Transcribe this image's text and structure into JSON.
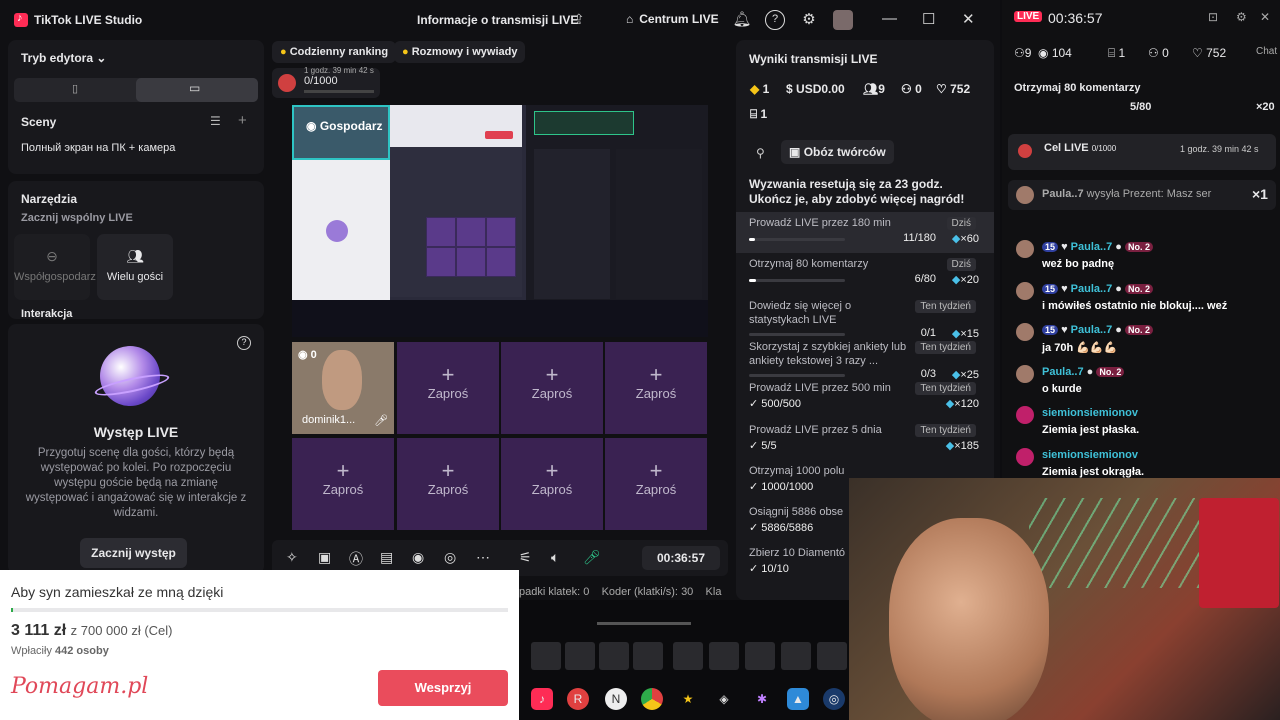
{
  "app": {
    "title": "TikTok LIVE Studio",
    "center_title": "Informacje o transmisji LIVE",
    "home": "Centrum LIVE"
  },
  "left": {
    "editor_mode": "Tryb edytora",
    "scenes": "Sceny",
    "scene_item": "Полный экран на ПК + камера",
    "tools": "Narzędzia",
    "tools_sub": "Zacznij wspólny LIVE",
    "cohost": "Współgospodarz",
    "multi": "Wielu gości",
    "interaction": "Interakcja",
    "perf_title": "Występ LIVE",
    "perf_desc": "Przygotuj scenę dla gości, którzy będą występować po kolei. Po rozpoczęciu występu goście będą na zmianę występować i angażować się w interakcje z widzami.",
    "start_btn": "Zacznij występ"
  },
  "center": {
    "ranking": "Codzienny ranking",
    "talk": "Rozmowy i wywiady",
    "goal": "0/1000",
    "goal_time": "1 godz. 39 min 42 s",
    "host_label": "Gospodarz",
    "cam_count": "0",
    "cam_name": "dominik1...",
    "invite": "Zaproś",
    "timer": "00:36:57"
  },
  "results": {
    "title": "Wyniki transmisji LIVE",
    "s1": "1",
    "s2": "USD0.00",
    "s3": "9",
    "s4": "0",
    "s5": "752",
    "s6": "1",
    "creators": "Obóz twórców",
    "reset": "Wyzwania resetują się za 23 godz. Ukończ je, aby zdobyć więcej nagród!",
    "tasks": [
      {
        "t": "Prowadź LIVE przez 180 min",
        "badge": "Dziś",
        "cnt": "11/180",
        "rw": "×60",
        "p": 0.06
      },
      {
        "t": "Otrzymaj 80 komentarzy",
        "badge": "Dziś",
        "cnt": "6/80",
        "rw": "×20",
        "p": 0.075
      },
      {
        "t": "Dowiedz się więcej o statystykach LIVE",
        "badge": "Ten tydzień",
        "cnt": "0/1",
        "rw": "×15",
        "p": 0
      },
      {
        "t": "Skorzystaj z szybkiej ankiety lub ankiety tekstowej 3 razy ...",
        "badge": "Ten tydzień",
        "cnt": "0/3",
        "rw": "×25",
        "p": 0
      },
      {
        "t": "Prowadź LIVE przez 500 min",
        "badge": "Ten tydzień",
        "cnt": "500/500",
        "rw": "×120",
        "done": true
      },
      {
        "t": "Prowadź LIVE przez 5 dnia",
        "badge": "Ten tydzień",
        "cnt": "5/5",
        "rw": "×185",
        "done": true
      },
      {
        "t": "Otrzymaj 1000 polu",
        "badge": "",
        "cnt": "1000/1000",
        "rw": "",
        "done": true
      },
      {
        "t": "Osiągnij 5886 obse",
        "badge": "",
        "cnt": "5886/5886",
        "rw": "",
        "done": true
      },
      {
        "t": "Zbierz 10 Diamentó",
        "badge": "",
        "cnt": "10/10",
        "rw": "",
        "done": true
      }
    ]
  },
  "chat": {
    "live": "LIVE",
    "time": "00:36:57",
    "c1": "9",
    "c2": "104",
    "c3": "1",
    "c4": "0",
    "c5": "752",
    "chat_label": "Chat",
    "ticker": "Otrzymaj 80 komentarzy",
    "ticker_cnt": "5/80",
    "ticker_rw": "×20",
    "goal": "Cel LIVE",
    "goal_val": "0/1000",
    "goal_time": "1 godz. 39 min 42 s",
    "gift": "Paula..7",
    "gift_text": "wysyła Prezent: Masz ser",
    "gift_x": "×1",
    "msgs": [
      {
        "user": "Paula..7",
        "lvl": "15",
        "no": "No. 2",
        "text": "weź bo padnę"
      },
      {
        "user": "Paula..7",
        "lvl": "15",
        "no": "No. 2",
        "text": "i mówiłeś ostatnio nie blokuj.... weź"
      },
      {
        "user": "Paula..7",
        "lvl": "15",
        "no": "No. 2",
        "text": "ja 70h 💪🏻💪🏻💪🏻"
      },
      {
        "user": "Paula..7",
        "lvl": "",
        "no": "No. 2",
        "text": "o kurde"
      },
      {
        "user": "siemionsiemionov",
        "lvl": "",
        "no": "",
        "text": "Ziemia jest płaska."
      },
      {
        "user": "siemionsiemionov",
        "lvl": "",
        "no": "",
        "text": "Ziemia jest okrągła."
      }
    ]
  },
  "donation": {
    "title": "Aby syn zamieszkał ze mną dzięki",
    "amount": "3 111 zł",
    "goal": "z 700 000 zł (Cel)",
    "payers_label": "Wpłaciły",
    "payers": "442 osoby",
    "brand": "Pomagam.pl",
    "btn": "Wesprzyj",
    "progress": 0.004
  },
  "status": {
    "frames": "padki klatek:",
    "frames_v": "0",
    "coder": "Koder (klatki/s):",
    "coder_v": "30",
    "kla": "Kla"
  }
}
